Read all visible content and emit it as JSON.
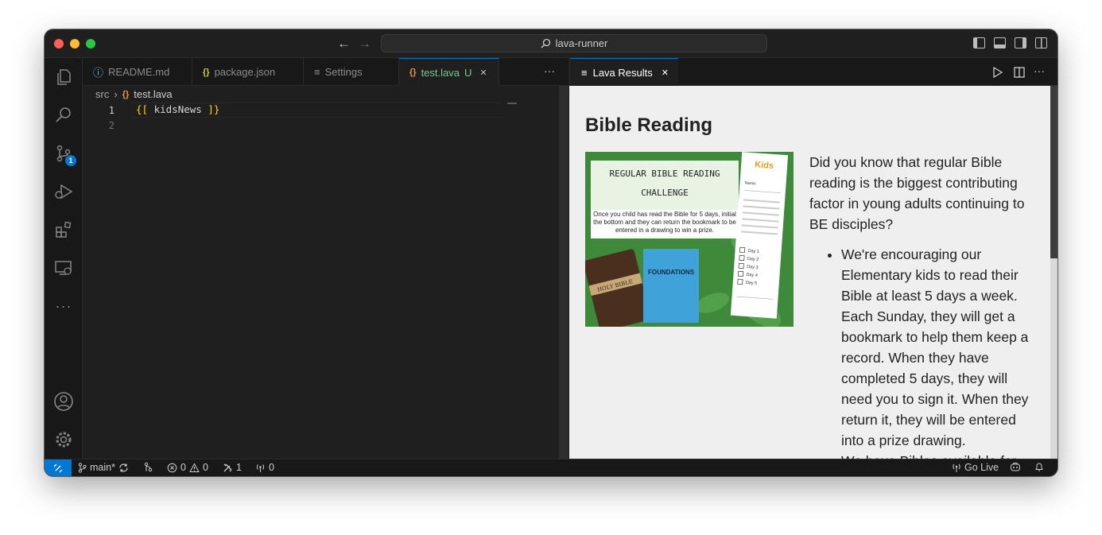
{
  "titlebar": {
    "search_text": "lava-runner",
    "back": "←",
    "forward": "→"
  },
  "activity": {
    "scm_badge": "1"
  },
  "editor": {
    "tabs": [
      {
        "icon": "ⓘ",
        "label": "README.md"
      },
      {
        "icon": "{}",
        "label": "package.json"
      },
      {
        "icon": "≡",
        "label": "Settings"
      },
      {
        "icon": "{}",
        "label": "test.lava",
        "status": "U",
        "close": "✕"
      }
    ],
    "more": "···",
    "breadcrumb": {
      "folder": "src",
      "sep": "›",
      "icon": "{}",
      "file": "test.lava"
    },
    "line_numbers": [
      "1",
      "2"
    ],
    "code_line1": {
      "open": "{[",
      "name": "kidsNews",
      "close": "]}"
    }
  },
  "preview": {
    "tab": {
      "icon": "≡",
      "label": "Lava Results",
      "close": "✕"
    },
    "heading": "Bible Reading",
    "intro": "Did you know that regular Bible reading is the biggest contributing factor in young adults continuing to BE disciples?",
    "bullets": [
      "We're encouraging our Elementary kids to read their Bible at least 5 days a week. Each Sunday, they will get a bookmark to help them keep a record. When they have completed 5 days, they will need you to sign it. When they return it, they will be entered into a prize drawing.",
      "We have Bibles available for"
    ],
    "image": {
      "title1": "REGULAR BIBLE READING",
      "title2": "CHALLENGE",
      "body": "Once you child has read the Bible for 5 days, initial the bottom and they can return the bookmark to be entered in a drawing to win a prize.",
      "book_label": "HOLY BIBLE",
      "book2": "FOUNDATIONS",
      "bookmark_logo": "Kids",
      "bookmark_name": "Name:",
      "days": [
        "Day 1",
        "Day 2",
        "Day 3",
        "Day 4",
        "Day 5"
      ]
    }
  },
  "status": {
    "branch": "main*",
    "errors": "0",
    "warnings": "0",
    "tools": "1",
    "ports": "0",
    "go_live": "Go Live"
  }
}
